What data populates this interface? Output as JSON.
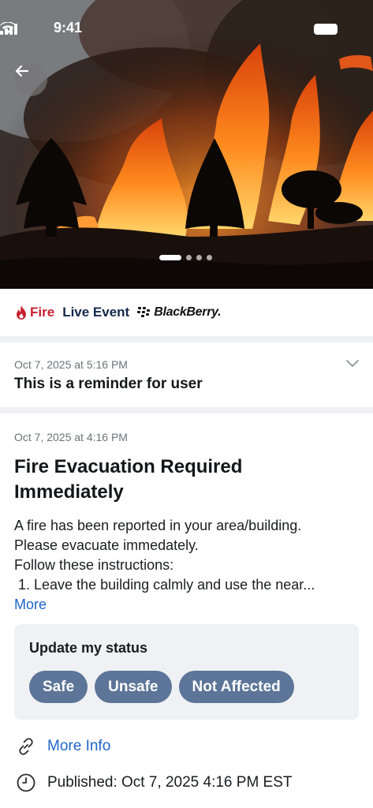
{
  "status_bar": {
    "time": "9:41"
  },
  "hero": {
    "slides": 4,
    "active_slide": 1
  },
  "brand": {
    "category": "Fire",
    "live_label": "Live Event",
    "logo_text": "BlackBerry."
  },
  "reminder": {
    "timestamp": "Oct 7, 2025 at 5:16 PM",
    "text": "This is a reminder for user"
  },
  "alert": {
    "timestamp": "Oct 7, 2025 at 4:16 PM",
    "title_line1": "Fire Evacuation Required",
    "title_line2": "Immediately",
    "body_lines": [
      "A fire has been reported in your area/building.",
      "Please evacuate immedately.",
      "Follow these instructions:",
      " 1. Leave the building calmly and use the near..."
    ],
    "more_label": "More"
  },
  "status_update": {
    "label": "Update my status",
    "options": [
      "Safe",
      "Unsafe",
      "Not Affected"
    ]
  },
  "more_info_label": "More Info",
  "published": "Published: Oct 7, 2025 4:16 PM EST",
  "colors": {
    "fire_red": "#c8202f",
    "navy": "#14284b",
    "link_blue": "#1f66c9",
    "chip_bg": "#5c7598"
  }
}
